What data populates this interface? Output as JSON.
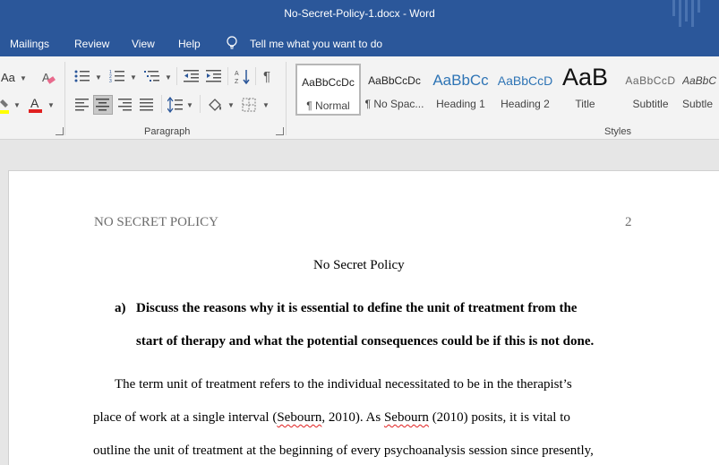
{
  "window": {
    "title": "No-Secret-Policy-1.docx  -  Word"
  },
  "menu": {
    "items": [
      "Mailings",
      "Review",
      "View",
      "Help"
    ],
    "tell_me": "Tell me what you want to do"
  },
  "ribbon": {
    "font_partial": "Aa",
    "groups": {
      "paragraph": "Paragraph",
      "styles": "Styles"
    },
    "styles": [
      {
        "sample": "AaBbCcDc",
        "name": "¶ Normal"
      },
      {
        "sample": "AaBbCcDc",
        "name": "¶ No Spac..."
      },
      {
        "sample": "AaBbCc",
        "name": "Heading 1"
      },
      {
        "sample": "AaBbCcD",
        "name": "Heading 2"
      },
      {
        "sample": "AaB",
        "name": "Title"
      },
      {
        "sample": "AaBbCcD",
        "name": "Subtitle"
      },
      {
        "sample": "AaBbC",
        "name": "Subtle"
      }
    ],
    "colors": {
      "highlight": "#ffff00",
      "font_color": "#e02020",
      "accent": "#2b579a"
    }
  },
  "document": {
    "header_left": "NO SECRET POLICY",
    "page_number": "2",
    "title": "No Secret Policy",
    "question_marker": "a)",
    "question_line1": "Discuss the reasons why it is essential to define the unit of treatment from the",
    "question_line2": "start of therapy and what the potential consequences could be if this is not done.",
    "body_line1": "The term unit of treatment refers to the individual necessitated to be in the therapist’s",
    "body_line2_a": "place of work at a single interval (",
    "body_line2_b": "Sebourn",
    "body_line2_c": ", 2010). As ",
    "body_line2_d": "Sebourn",
    "body_line2_e": " (2010) posits, it is vital to",
    "body_line3": "outline the unit of treatment at the beginning of every psychoanalysis session since presently,"
  }
}
